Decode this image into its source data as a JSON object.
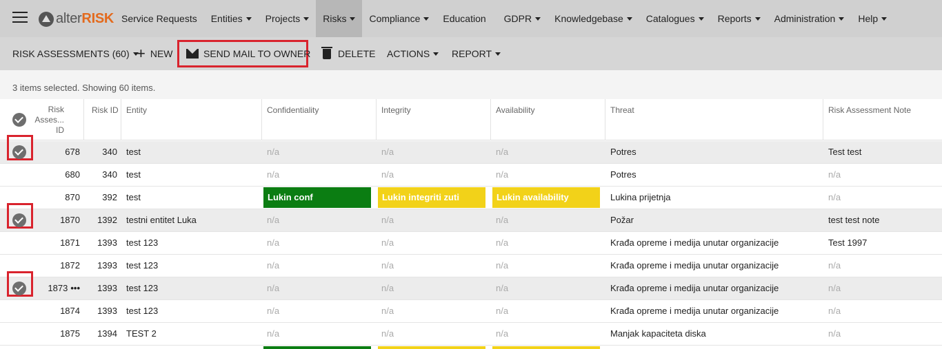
{
  "app": {
    "logo_prefix": "alter",
    "logo_accent": "RISK"
  },
  "menu": [
    {
      "label": "Service Requests",
      "dropdown": false
    },
    {
      "label": "Entities",
      "dropdown": true
    },
    {
      "label": "Projects",
      "dropdown": true
    },
    {
      "label": "Risks",
      "dropdown": true,
      "active": true
    },
    {
      "label": "Compliance",
      "dropdown": true
    },
    {
      "label": "Education",
      "dropdown": false
    },
    {
      "label": "GDPR",
      "dropdown": true
    },
    {
      "label": "Knowledgebase",
      "dropdown": true
    },
    {
      "label": "Catalogues",
      "dropdown": true
    },
    {
      "label": "Reports",
      "dropdown": true
    },
    {
      "label": "Administration",
      "dropdown": true
    },
    {
      "label": "Help",
      "dropdown": true
    }
  ],
  "toolbar": {
    "view_label": "RISK ASSESSMENTS (60)",
    "new_label": "NEW",
    "send_mail_label": "SEND MAIL TO OWNER",
    "delete_label": "DELETE",
    "actions_label": "ACTIONS",
    "report_label": "REPORT"
  },
  "status": {
    "text": "3 items selected. Showing 60 items."
  },
  "table": {
    "columns": {
      "risk_assessment_id_line1": "Risk",
      "risk_assessment_id_line2": "Asses...",
      "risk_assessment_id_line3": "ID",
      "risk_id": "Risk ID",
      "entity": "Entity",
      "confidentiality": "Confidentiality",
      "integrity": "Integrity",
      "availability": "Availability",
      "threat": "Threat",
      "note": "Risk Assessment Note"
    },
    "rows": [
      {
        "id": "678",
        "risk_id": "340",
        "entity": "test",
        "conf": "n/a",
        "integ": "n/a",
        "avail": "n/a",
        "threat": "Potres",
        "note": "Test test",
        "selected": true
      },
      {
        "id": "680",
        "risk_id": "340",
        "entity": "test",
        "conf": "n/a",
        "integ": "n/a",
        "avail": "n/a",
        "threat": "Potres",
        "note": "n/a",
        "selected": false
      },
      {
        "id": "870",
        "risk_id": "392",
        "entity": "test",
        "conf": "Lukin conf",
        "integ": "Lukin integriti zuti",
        "avail": "Lukin availability",
        "threat": "Lukina prijetnja",
        "note": "n/a",
        "selected": false
      },
      {
        "id": "1870",
        "risk_id": "1392",
        "entity": "testni entitet Luka",
        "conf": "n/a",
        "integ": "n/a",
        "avail": "n/a",
        "threat": "Požar",
        "note": "test test note",
        "selected": true
      },
      {
        "id": "1871",
        "risk_id": "1393",
        "entity": "test 123",
        "conf": "n/a",
        "integ": "n/a",
        "avail": "n/a",
        "threat": "Krađa opreme i medija unutar organizacije",
        "note": "Test 1997",
        "selected": false
      },
      {
        "id": "1872",
        "risk_id": "1393",
        "entity": "test 123",
        "conf": "n/a",
        "integ": "n/a",
        "avail": "n/a",
        "threat": "Krađa opreme i medija unutar organizacije",
        "note": "n/a",
        "selected": false
      },
      {
        "id": "1873",
        "risk_id": "1393",
        "entity": "test 123",
        "conf": "n/a",
        "integ": "n/a",
        "avail": "n/a",
        "threat": "Krađa opreme i medija unutar organizacije",
        "note": "n/a",
        "selected": true,
        "more": "•••"
      },
      {
        "id": "1874",
        "risk_id": "1393",
        "entity": "test 123",
        "conf": "n/a",
        "integ": "n/a",
        "avail": "n/a",
        "threat": "Krađa opreme i medija unutar organizacije",
        "note": "n/a",
        "selected": false
      },
      {
        "id": "1875",
        "risk_id": "1394",
        "entity": "TEST 2",
        "conf": "n/a",
        "integ": "n/a",
        "avail": "n/a",
        "threat": "Manjak kapaciteta diska",
        "note": "n/a",
        "selected": false
      }
    ]
  },
  "colors": {
    "highlight_box": "#d9232d",
    "green_badge": "#0b7d12",
    "yellow_badge": "#f2d219",
    "logo_accent": "#e36a1d"
  }
}
